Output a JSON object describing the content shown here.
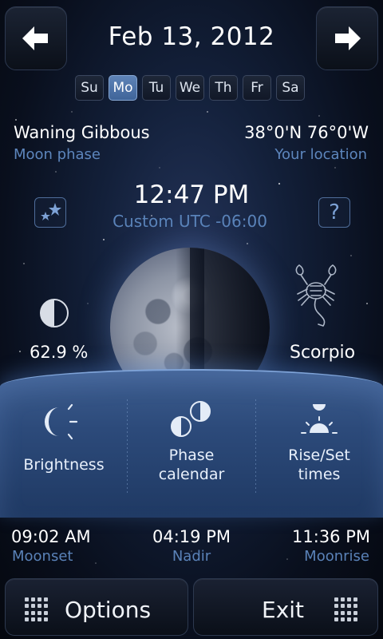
{
  "header": {
    "date": "Feb 13, 2012",
    "prev_icon": "arrow-left-icon",
    "next_icon": "arrow-right-icon"
  },
  "weekdays": [
    "Su",
    "Mo",
    "Tu",
    "We",
    "Th",
    "Fr",
    "Sa"
  ],
  "selected_weekday": "Mo",
  "moon_phase": {
    "value": "Waning Gibbous",
    "label": "Moon phase"
  },
  "location": {
    "value": "38°0'N 76°0'W",
    "label": "Your location"
  },
  "clock": {
    "time": "12:47 PM",
    "timezone": "Custom UTC -06:00"
  },
  "illumination": {
    "value": "62.9 %",
    "icon": "half-moon-icon"
  },
  "zodiac": {
    "value": "Scorpio",
    "icon": "scorpion-icon"
  },
  "panel": {
    "brightness": "Brightness",
    "phase_calendar_line1": "Phase",
    "phase_calendar_line2": "calendar",
    "riseset_line1": "Rise/Set",
    "riseset_line2": "times"
  },
  "times": {
    "moonset": {
      "time": "09:02 AM",
      "label": "Moonset"
    },
    "nadir": {
      "time": "04:19 PM",
      "label": "Nadir"
    },
    "moonrise": {
      "time": "11:36 PM",
      "label": "Moonrise"
    }
  },
  "buttons": {
    "options": "Options",
    "exit": "Exit"
  },
  "colors": {
    "accent": "#5d86bd",
    "panel": "#2c4a7a",
    "selected_day": "#4f74a8"
  }
}
